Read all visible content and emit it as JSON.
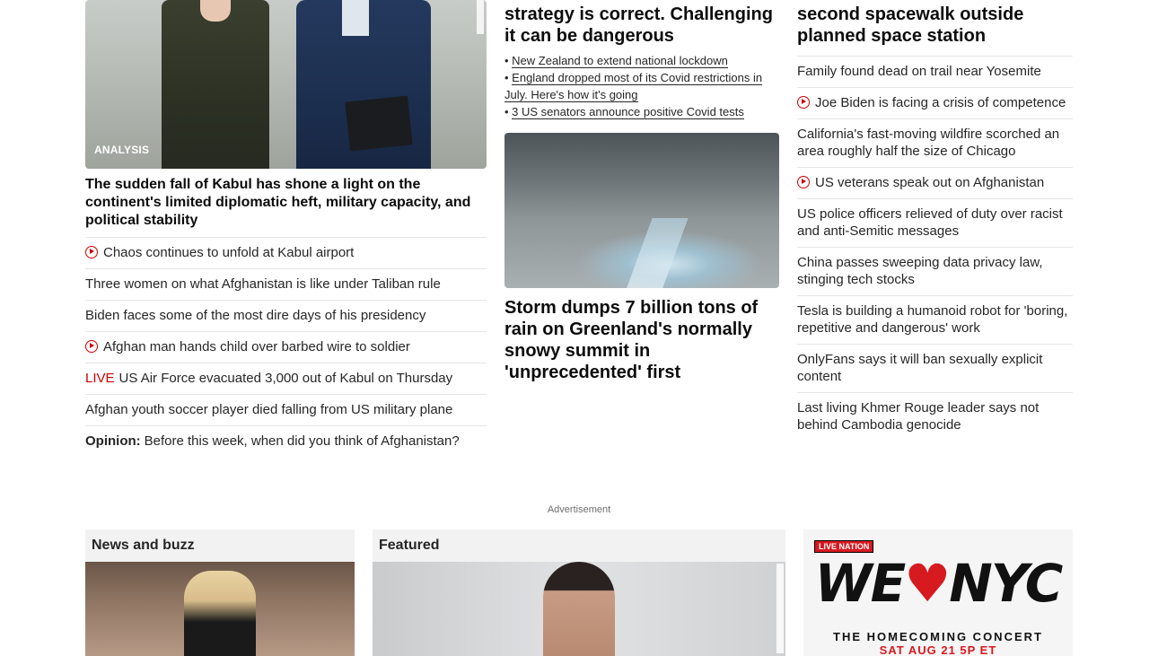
{
  "col1": {
    "hero_badge": "ANALYSIS",
    "hero_title": "The sudden fall of Kabul has shone a light on the continent's limited diplomatic heft, military capacity, and political stability",
    "items": [
      {
        "text": "Chaos continues to unfold at Kabul airport",
        "icon": "play-icon"
      },
      {
        "text": "Three women on what Afghanistan is like under Taliban rule"
      },
      {
        "text": "Biden faces some of the most dire days of his presidency"
      },
      {
        "text": "Afghan man hands child over barbed wire to soldier",
        "icon": "play-icon"
      },
      {
        "live": "LIVE",
        "text": "US Air Force evacuated 3,000 out of Kabul on Thursday"
      },
      {
        "text": "Afghan youth soccer player died falling from US military plane"
      },
      {
        "prefix": "Opinion:",
        "text": "Before this week, when did you think of Afghanistan?"
      }
    ]
  },
  "col2": {
    "headline": "China insists its Zero-Covid strategy is correct. Challenging it can be dangerous",
    "sub_links": [
      "New Zealand to extend national lockdown",
      "England dropped most of its Covid restrictions in July. Here's how it's going",
      "3 US senators announce positive Covid tests"
    ],
    "storm_title": "Storm dumps 7 billion tons of rain on Greenland's normally snowy summit in 'unprecedented' first"
  },
  "col3": {
    "headline": "Chinese astronauts conduct second spacewalk outside planned space station",
    "items": [
      {
        "text": "Family found dead on trail near Yosemite"
      },
      {
        "text": "Joe Biden is facing a crisis of competence",
        "icon": "play-icon"
      },
      {
        "text": "California's fast-moving wildfire scorched an area roughly half the size of Chicago"
      },
      {
        "text": "US veterans speak out on Afghanistan",
        "icon": "play-icon"
      },
      {
        "text": "US police officers relieved of duty over racist and anti-Semitic messages"
      },
      {
        "text": "China passes sweeping data privacy law, stinging tech stocks"
      },
      {
        "text": "Tesla is building a humanoid robot for 'boring, repetitive and dangerous' work"
      },
      {
        "text": "OnlyFans says it will ban sexually explicit content"
      },
      {
        "text": "Last living Khmer Rouge leader says not behind Cambodia genocide"
      }
    ]
  },
  "advertisement_label": "Advertisement",
  "bottom": {
    "news_buzz_title": "News and buzz",
    "featured_title": "Featured",
    "ad": {
      "logo": "LIVE NATION",
      "we": "WE",
      "heart": "♥",
      "nyc": "NYC",
      "line1": "THE HOMECOMING CONCERT",
      "line2": "SAT AUG 21 5P ET"
    }
  },
  "colors": {
    "accent_red": "#cc0000"
  }
}
